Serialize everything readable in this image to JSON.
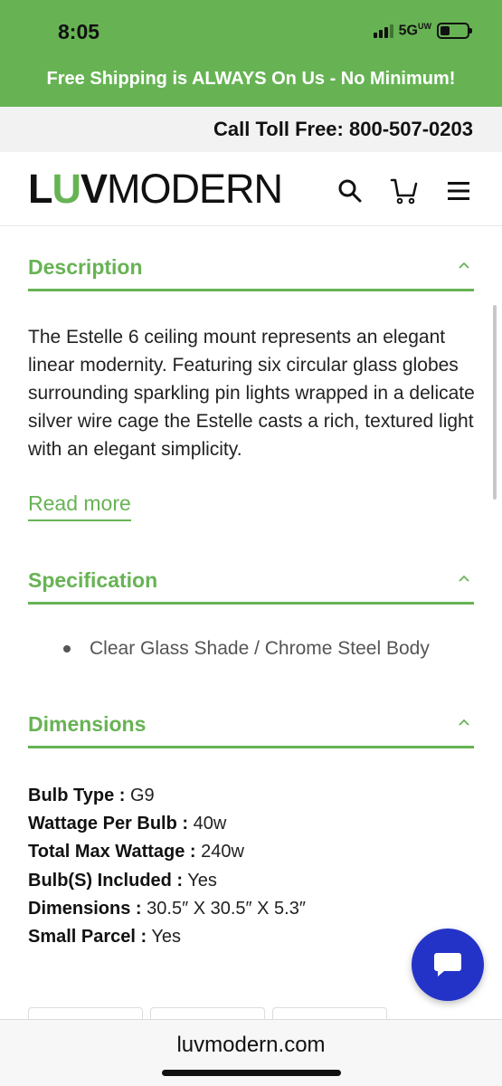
{
  "status_bar": {
    "time": "8:05",
    "network": "5G",
    "network_sup": "UW"
  },
  "promo_banner": {
    "text": "Free Shipping is ALWAYS On Us - No Minimum!"
  },
  "toll_bar": {
    "text": "Call Toll Free: 800-507-0203"
  },
  "header": {
    "logo_parts": [
      "L",
      "U",
      "V",
      "MODERN"
    ],
    "icons": [
      "search-icon",
      "cart-icon",
      "menu-icon"
    ]
  },
  "description": {
    "title": "Description",
    "body": "The Estelle 6 ceiling mount represents an elegant linear modernity. Featuring six circular glass globes surrounding sparkling pin lights wrapped in a delicate silver wire cage the Estelle casts a rich, textured light with an elegant simplicity.",
    "read_more": "Read more"
  },
  "specification": {
    "title": "Specification",
    "items": [
      "Clear Glass Shade / Chrome Steel Body"
    ]
  },
  "dimensions": {
    "title": "Dimensions",
    "rows": [
      {
        "key": "Bulb Type :",
        "value": "G9"
      },
      {
        "key": "Wattage Per Bulb :",
        "value": "40w"
      },
      {
        "key": "Total Max Wattage :",
        "value": "240w"
      },
      {
        "key": "Bulb(S) Included :",
        "value": "Yes"
      },
      {
        "key": "Dimensions :",
        "value": "30.5″ X 30.5″ X 5.3″"
      },
      {
        "key": "Small Parcel :",
        "value": "Yes"
      }
    ]
  },
  "browser": {
    "url": "luvmodern.com"
  },
  "colors": {
    "brand_green": "#67b354",
    "chat_blue": "#2433c7"
  }
}
